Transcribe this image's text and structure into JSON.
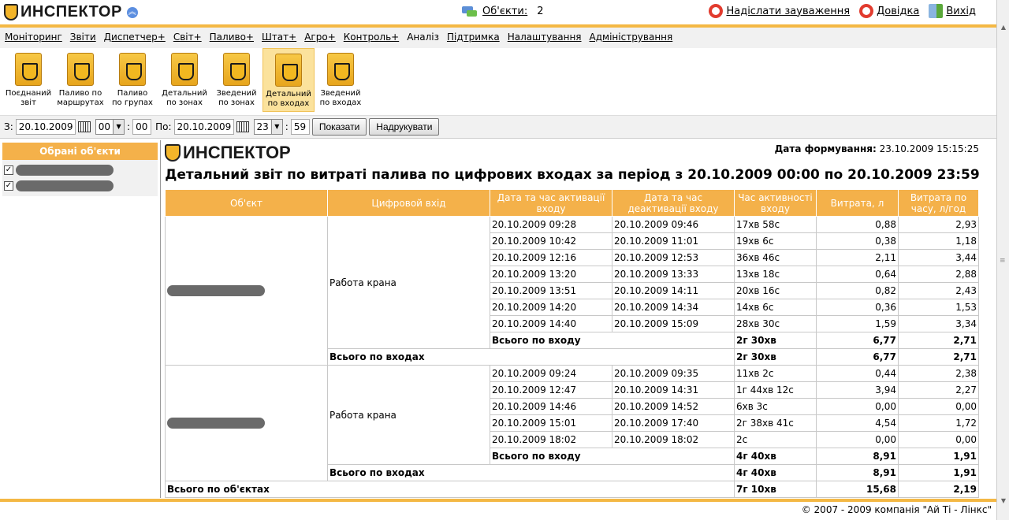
{
  "header": {
    "logo": "ИНСПЕКТОР",
    "objects_label": "Об'єкти:",
    "objects_count": "2",
    "links": {
      "feedback": "Надіслати зауваження",
      "help": "Довідка",
      "exit": "Вихід"
    }
  },
  "menu": [
    "Моніторинг",
    "Звіти",
    "Диспетчер+",
    "Світ+",
    "Паливо+",
    "Штат+",
    "Агро+",
    "Контроль+",
    "Аналіз",
    "Підтримка",
    "Налаштування",
    "Адміністрування"
  ],
  "menu_active": "Аналіз",
  "tiles": [
    {
      "line1": "Поєднаний",
      "line2": "звіт"
    },
    {
      "line1": "Паливо по",
      "line2": "маршрутах"
    },
    {
      "line1": "Паливо",
      "line2": "по групах"
    },
    {
      "line1": "Детальний",
      "line2": "по зонах"
    },
    {
      "line1": "Зведений",
      "line2": "по зонах"
    },
    {
      "line1": "Детальний",
      "line2": "по входах"
    },
    {
      "line1": "Зведений",
      "line2": "по входах"
    }
  ],
  "toolbar": {
    "from_label": "З:",
    "from_date": "20.10.2009",
    "from_hour": "00",
    "from_min": "00",
    "to_label": "По:",
    "to_date": "20.10.2009",
    "to_hour": "23",
    "to_min": "59",
    "show_btn": "Показати",
    "print_btn": "Надрукувати"
  },
  "left_panel": {
    "title": "Обрані об'єкти"
  },
  "report": {
    "logo": "ИНСПЕКТОР",
    "gen_label": "Дата формування:",
    "gen_date": "23.10.2009 15:15:25",
    "title": "Детальний звіт по витраті палива по цифрових входах за період з 20.10.2009 00:00 по 20.10.2009 23:59",
    "columns": [
      "Об'єкт",
      "Цифровой вхід",
      "Дата та час активації входу",
      "Дата та час деактивації входу",
      "Час активності входу",
      "Витрата, л",
      "Витрата по часу, л/год"
    ],
    "objects": [
      {
        "input": "Работа крана",
        "rows": [
          [
            "20.10.2009 09:28",
            "20.10.2009 09:46",
            "17хв 58с",
            "0,88",
            "2,93"
          ],
          [
            "20.10.2009 10:42",
            "20.10.2009 11:01",
            "19хв 6с",
            "0,38",
            "1,18"
          ],
          [
            "20.10.2009 12:16",
            "20.10.2009 12:53",
            "36хв 46с",
            "2,11",
            "3,44"
          ],
          [
            "20.10.2009 13:20",
            "20.10.2009 13:33",
            "13хв 18с",
            "0,64",
            "2,88"
          ],
          [
            "20.10.2009 13:51",
            "20.10.2009 14:11",
            "20хв 16с",
            "0,82",
            "2,43"
          ],
          [
            "20.10.2009 14:20",
            "20.10.2009 14:34",
            "14хв 6с",
            "0,36",
            "1,53"
          ],
          [
            "20.10.2009 14:40",
            "20.10.2009 15:09",
            "28хв 30с",
            "1,59",
            "3,34"
          ]
        ],
        "input_total": {
          "label": "Всього по входу",
          "time": "2г 30хв",
          "fuel": "6,77",
          "rate": "2,71"
        },
        "inputs_total": {
          "label": "Всього по входах",
          "time": "2г 30хв",
          "fuel": "6,77",
          "rate": "2,71"
        }
      },
      {
        "input": "Работа крана",
        "rows": [
          [
            "20.10.2009 09:24",
            "20.10.2009 09:35",
            "11хв 2с",
            "0,44",
            "2,38"
          ],
          [
            "20.10.2009 12:47",
            "20.10.2009 14:31",
            "1г 44хв 12с",
            "3,94",
            "2,27"
          ],
          [
            "20.10.2009 14:46",
            "20.10.2009 14:52",
            "6хв 3с",
            "0,00",
            "0,00"
          ],
          [
            "20.10.2009 15:01",
            "20.10.2009 17:40",
            "2г 38хв 41с",
            "4,54",
            "1,72"
          ],
          [
            "20.10.2009 18:02",
            "20.10.2009 18:02",
            "2с",
            "0,00",
            "0,00"
          ]
        ],
        "input_total": {
          "label": "Всього по входу",
          "time": "4г 40хв",
          "fuel": "8,91",
          "rate": "1,91"
        },
        "inputs_total": {
          "label": "Всього по входах",
          "time": "4г 40хв",
          "fuel": "8,91",
          "rate": "1,91"
        }
      }
    ],
    "grand_total": {
      "label": "Всього по об'єктах",
      "time": "7г 10хв",
      "fuel": "15,68",
      "rate": "2,19"
    }
  },
  "footer": "© 2007 - 2009 компанія \"Ай Ті - Лінкс\""
}
